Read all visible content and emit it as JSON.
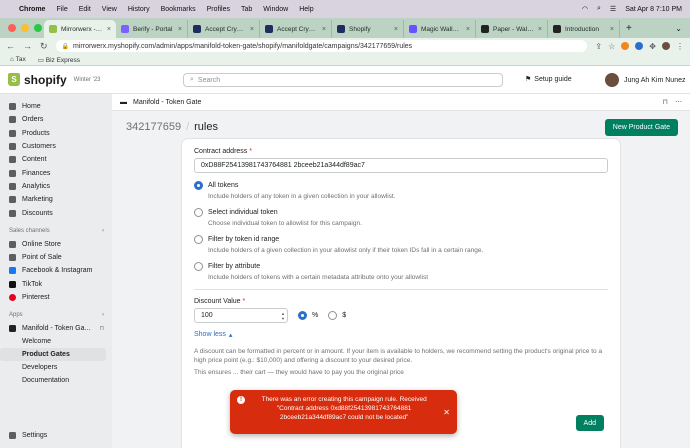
{
  "menubar": {
    "app": "Chrome",
    "items": [
      "File",
      "Edit",
      "View",
      "History",
      "Bookmarks",
      "Profiles",
      "Tab",
      "Window",
      "Help"
    ],
    "datetime": "Sat Apr 8  7:10 PM"
  },
  "tabs": [
    {
      "label": "Mirrorwerx - rule",
      "color": "#95bf47",
      "active": true
    },
    {
      "label": "Berify - Portal",
      "color": "#7b61ff"
    },
    {
      "label": "Accept Crypto P",
      "color": "#1f2d5c"
    },
    {
      "label": "Accept Crypto P",
      "color": "#1f2d5c"
    },
    {
      "label": "Shopify",
      "color": "#1f2d5c"
    },
    {
      "label": "Magic Wallet Se",
      "color": "#6851ff"
    },
    {
      "label": "Paper - Wallets",
      "color": "#222"
    },
    {
      "label": "Introduction",
      "color": "#222"
    }
  ],
  "address": {
    "url": "mirrorwerx.myshopify.com/admin/apps/manifold-token-gate/shopify/manifoldgate/campaigns/342177659/rules"
  },
  "bookmarks": [
    "Tax",
    "Biz Express"
  ],
  "shopify": {
    "logo": "shopify",
    "edition": "Winter '23",
    "search_placeholder": "Search",
    "setup_guide": "Setup guide",
    "user_name": "Jung Ah Kim Nunez"
  },
  "sidebar": {
    "items": [
      "Home",
      "Orders",
      "Products",
      "Customers",
      "Content",
      "Finances",
      "Analytics",
      "Marketing",
      "Discounts"
    ],
    "sales_channels_label": "Sales channels",
    "channels": [
      "Online Store",
      "Point of Sale",
      "Facebook & Instagram",
      "TikTok",
      "Pinterest"
    ],
    "apps_label": "Apps",
    "app_name": "Manifold - Token Ga...",
    "app_subitems": [
      "Welcome",
      "Product Gates",
      "Developers",
      "Documentation"
    ],
    "active_subitem": "Product Gates",
    "settings": "Settings"
  },
  "appbar": {
    "title": "Manifold - Token Gate"
  },
  "page": {
    "campaign_id": "342177659",
    "title": "rules",
    "primary_action": "New Product Gate"
  },
  "form": {
    "contract_label": "Contract address",
    "contract_value": "0xD88F25413981743764881 2bceeb21a344df89ac7",
    "options": [
      {
        "label": "All tokens",
        "help": "Include holders of any token in a given collection in your allowlist.",
        "selected": true
      },
      {
        "label": "Select individual token",
        "help": "Choose individual token to allowlist for this campaign.",
        "selected": false
      },
      {
        "label": "Filter by token id range",
        "help": "Include holders of a given collection in your allowlist only if their token IDs fall in a certain range.",
        "selected": false
      },
      {
        "label": "Filter by attribute",
        "help": "Include holders of tokens with a certain metadata attribute onto your allowlist",
        "selected": false
      }
    ],
    "discount_label": "Discount Value",
    "discount_value": "100",
    "unit_percent": "%",
    "unit_dollar": "$",
    "show_less": "Show less",
    "para1": "A discount can be formatted in percent or in amount. If your item is available to holders, we recommend setting the product's original price to a high price point (e.g.: $10,000) and offering a discount to your desired price.",
    "para2": "This ensures ... their cart — they would have to pay you the original price",
    "add": "Add"
  },
  "toast": {
    "message": "There was an error creating this campaign rule. Received \"Contract address 0xd88f25413981743764881 2bceeb21a344df89ac7 could not be located\""
  }
}
